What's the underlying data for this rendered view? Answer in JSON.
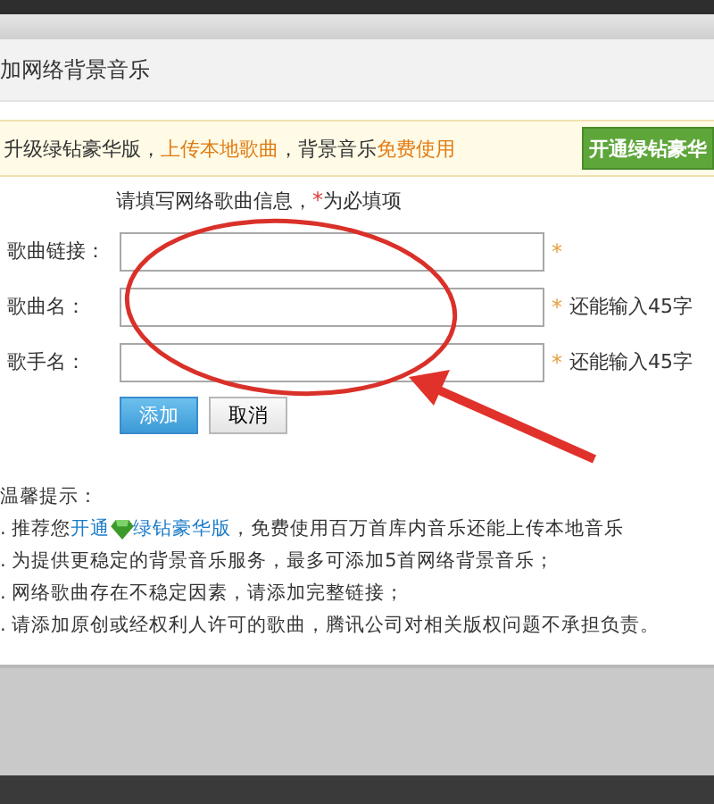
{
  "dialog": {
    "title": "加网络背景音乐"
  },
  "banner": {
    "parts": [
      {
        "text": "升级绿钻豪华版，",
        "kind": "plain"
      },
      {
        "text": "上传本地歌曲",
        "kind": "highlight"
      },
      {
        "text": "，背景音乐",
        "kind": "plain"
      },
      {
        "text": "免费使用",
        "kind": "highlight"
      }
    ],
    "button": "开通绿钻豪华"
  },
  "form": {
    "hint": [
      {
        "text": "请填写网络歌曲信息，",
        "kind": "plain"
      },
      {
        "text": "*",
        "kind": "required"
      },
      {
        "text": "为必填项",
        "kind": "plain"
      }
    ],
    "fields": [
      {
        "label": "歌曲链接：",
        "required": "*"
      },
      {
        "label": "歌曲名：",
        "required": "*",
        "counter": "还能输入45字"
      },
      {
        "label": "歌手名：",
        "required": "*",
        "counter": "还能输入45字"
      }
    ],
    "buttons": [
      {
        "label": "添加",
        "kind": "primary"
      },
      {
        "label": "取消",
        "kind": "secondary"
      }
    ]
  },
  "tips": {
    "heading": "温馨提示：",
    "items": [
      {
        "parts": [
          {
            "text": ". 推荐您",
            "kind": "plain"
          },
          {
            "text": "开通",
            "kind": "link"
          },
          {
            "kind": "diamond"
          },
          {
            "text": "绿钻豪华版",
            "kind": "link"
          },
          {
            "text": "，免费使用百万首库内音乐还能上传本地音乐",
            "kind": "plain"
          }
        ]
      },
      {
        "parts": [
          {
            "text": ". 为提供更稳定的背景音乐服务，最多可添加5首网络背景音乐；",
            "kind": "plain"
          }
        ]
      },
      {
        "parts": [
          {
            "text": ". 网络歌曲存在不稳定因素，请添加完整链接；",
            "kind": "plain"
          }
        ]
      },
      {
        "parts": [
          {
            "text": ". 请添加原创或经权利人许可的歌曲，腾讯公司对相关版权问题不承担负责。",
            "kind": "plain"
          }
        ]
      }
    ]
  }
}
